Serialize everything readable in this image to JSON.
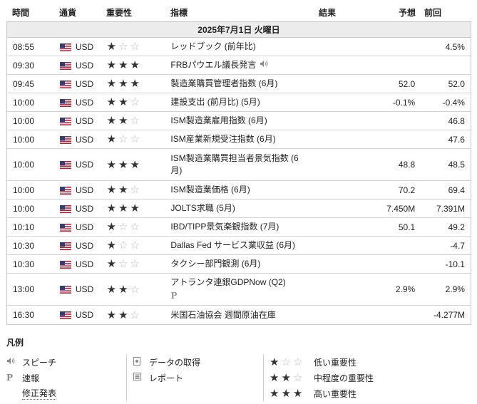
{
  "header": {
    "time": "時間",
    "currency": "通貨",
    "importance": "重要性",
    "indicator": "指標",
    "actual": "結果",
    "forecast": "予想",
    "previous": "前回"
  },
  "date_label": "2025年7月1日 火曜日",
  "rows": [
    {
      "time": "08:55",
      "currency": "USD",
      "importance": 1,
      "indicator": "レッドブック (前年比)",
      "actual": "",
      "forecast": "",
      "previous": "4.5%"
    },
    {
      "time": "09:30",
      "currency": "USD",
      "importance": 3,
      "indicator": "FRBパウエル議長発言",
      "speech": true,
      "actual": "",
      "forecast": "",
      "previous": ""
    },
    {
      "time": "09:45",
      "currency": "USD",
      "importance": 3,
      "indicator": "製造業購買管理者指数 (6月)",
      "actual": "",
      "forecast": "52.0",
      "previous": "52.0"
    },
    {
      "time": "10:00",
      "currency": "USD",
      "importance": 2,
      "indicator": "建設支出 (前月比) (5月)",
      "actual": "",
      "forecast": "-0.1%",
      "previous": "-0.4%"
    },
    {
      "time": "10:00",
      "currency": "USD",
      "importance": 2,
      "indicator": "ISM製造業雇用指数 (6月)",
      "actual": "",
      "forecast": "",
      "previous": "46.8"
    },
    {
      "time": "10:00",
      "currency": "USD",
      "importance": 1,
      "indicator": "ISM産業新規受注指数 (6月)",
      "actual": "",
      "forecast": "",
      "previous": "47.6"
    },
    {
      "time": "10:00",
      "currency": "USD",
      "importance": 3,
      "indicator": "ISM製造業購買担当者景気指数 (6月)",
      "tall": true,
      "actual": "",
      "forecast": "48.8",
      "previous": "48.5"
    },
    {
      "time": "10:00",
      "currency": "USD",
      "importance": 2,
      "indicator": "ISM製造業価格 (6月)",
      "actual": "",
      "forecast": "70.2",
      "previous": "69.4"
    },
    {
      "time": "10:00",
      "currency": "USD",
      "importance": 3,
      "indicator": "JOLTS求職 (5月)",
      "actual": "",
      "forecast": "7.450M",
      "previous": "7.391M"
    },
    {
      "time": "10:10",
      "currency": "USD",
      "importance": 1,
      "indicator": "IBD/TIPP景気楽観指数 (7月)",
      "actual": "",
      "forecast": "50.1",
      "previous": "49.2"
    },
    {
      "time": "10:30",
      "currency": "USD",
      "importance": 1,
      "indicator": "Dallas Fed サービス業収益 (6月)",
      "actual": "",
      "forecast": "",
      "previous": "-4.7"
    },
    {
      "time": "10:30",
      "currency": "USD",
      "importance": 1,
      "indicator": "タクシー部門観測 (6月)",
      "actual": "",
      "forecast": "",
      "previous": "-10.1"
    },
    {
      "time": "13:00",
      "currency": "USD",
      "importance": 2,
      "indicator": "アトランタ連銀GDPNow (Q2)",
      "tall": true,
      "preliminary": true,
      "actual": "",
      "forecast": "2.9%",
      "previous": "2.9%"
    },
    {
      "time": "16:30",
      "currency": "USD",
      "importance": 2,
      "indicator": "米国石油協会 週間原油在庫",
      "actual": "",
      "forecast": "",
      "previous": "-4.277M"
    }
  ],
  "legend": {
    "title": "凡例",
    "speech": "スピーチ",
    "preliminary": "速報",
    "revised": "修正発表",
    "data_retrieval": "データの取得",
    "report": "レポート",
    "low": "低い重要性",
    "medium": "中程度の重要性",
    "high": "高い重要性",
    "preliminary_mark": "P"
  },
  "icons": {
    "flag": "us-flag-icon",
    "star": "star-icon",
    "speaker": "speaker-icon",
    "prelim": "preliminary-icon",
    "doc": "document-icon",
    "report": "report-icon"
  },
  "colors": {
    "date_row_bg": "#ececec",
    "border": "#c8c8c8",
    "star_on": "#333333",
    "star_off": "#bbbbbb"
  }
}
